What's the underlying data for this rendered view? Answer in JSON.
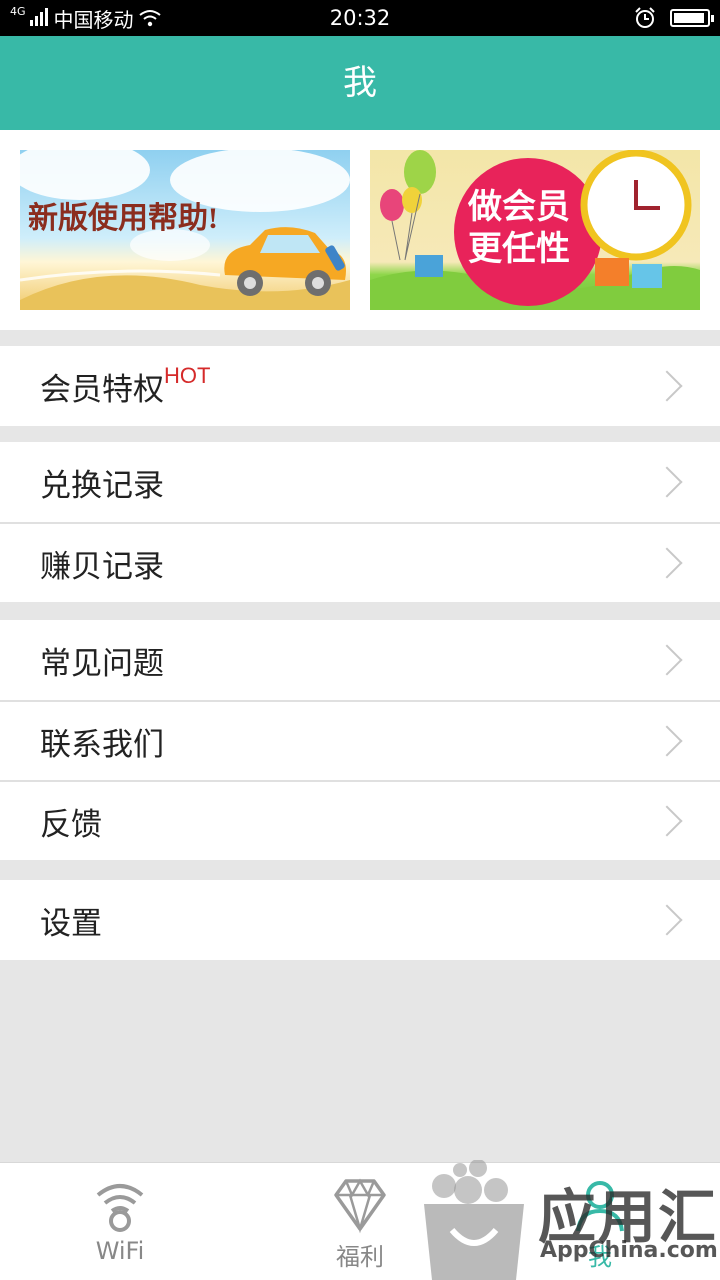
{
  "status_bar": {
    "network": "4G",
    "carrier": "中国移动",
    "time": "20:32"
  },
  "header": {
    "title": "我"
  },
  "banners": [
    {
      "text": "新版使用帮助!"
    },
    {
      "text_line1": "做会员",
      "text_line2": "更任性"
    }
  ],
  "menu": {
    "vip": {
      "label": "会员特权",
      "badge": "HOT"
    },
    "exchange_record": "兑换记录",
    "earn_record": "赚贝记录",
    "faq": "常见问题",
    "contact": "联系我们",
    "feedback": "反馈",
    "settings": "设置"
  },
  "tabbar": {
    "wifi": "WiFi",
    "welfare": "福利",
    "me": "我"
  },
  "watermark": {
    "brand": "应用汇",
    "domain": "AppChina.com"
  },
  "colors": {
    "accent": "#38b9a7",
    "hot": "#d52a2a"
  }
}
